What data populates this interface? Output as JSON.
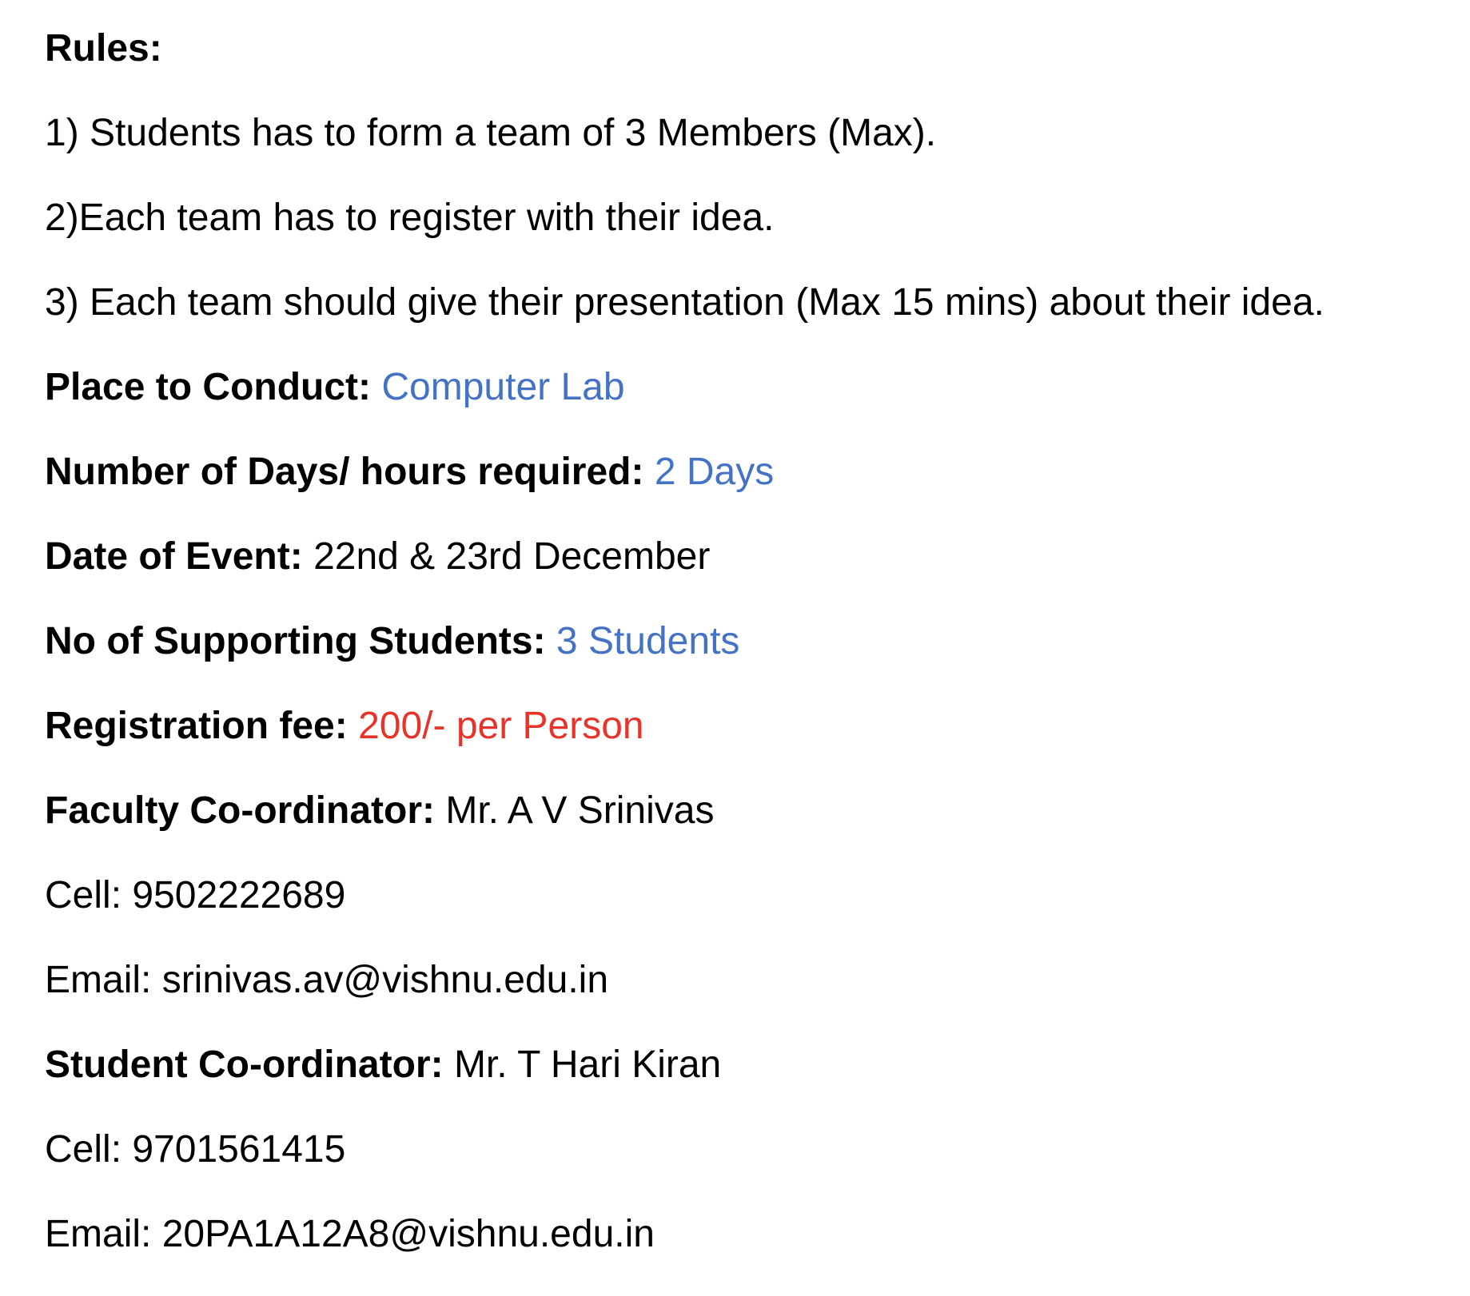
{
  "rules": {
    "heading": "Rules:",
    "items": [
      "1) Students has to form a team of 3 Members (Max).",
      "2)Each team has to register with their idea.",
      "3) Each team should give their presentation (Max 15 mins) about their idea."
    ]
  },
  "details": {
    "place": {
      "label": "Place to Conduct:",
      "value": "Computer Lab"
    },
    "days": {
      "label": "Number of Days/ hours required:",
      "value": "2 Days"
    },
    "date": {
      "label": "Date of Event:",
      "value": "22nd & 23rd December"
    },
    "supporting": {
      "label": "No of Supporting Students:",
      "value": "3 Students"
    },
    "fee": {
      "label": "Registration fee:",
      "value": "200/- per Person"
    }
  },
  "faculty": {
    "label": "Faculty Co-ordinator:",
    "name": "Mr. A V Srinivas",
    "cell": "Cell: 9502222689",
    "email": "Email: srinivas.av@vishnu.edu.in"
  },
  "student": {
    "label": "Student Co-ordinator:",
    "name": "Mr. T Hari Kiran",
    "cell": "Cell: 9701561415",
    "email": "Email: 20PA1A12A8@vishnu.edu.in"
  },
  "colors": {
    "accent_blue": "#4472C4",
    "fee_red": "#E8332A",
    "text": "#000000"
  }
}
